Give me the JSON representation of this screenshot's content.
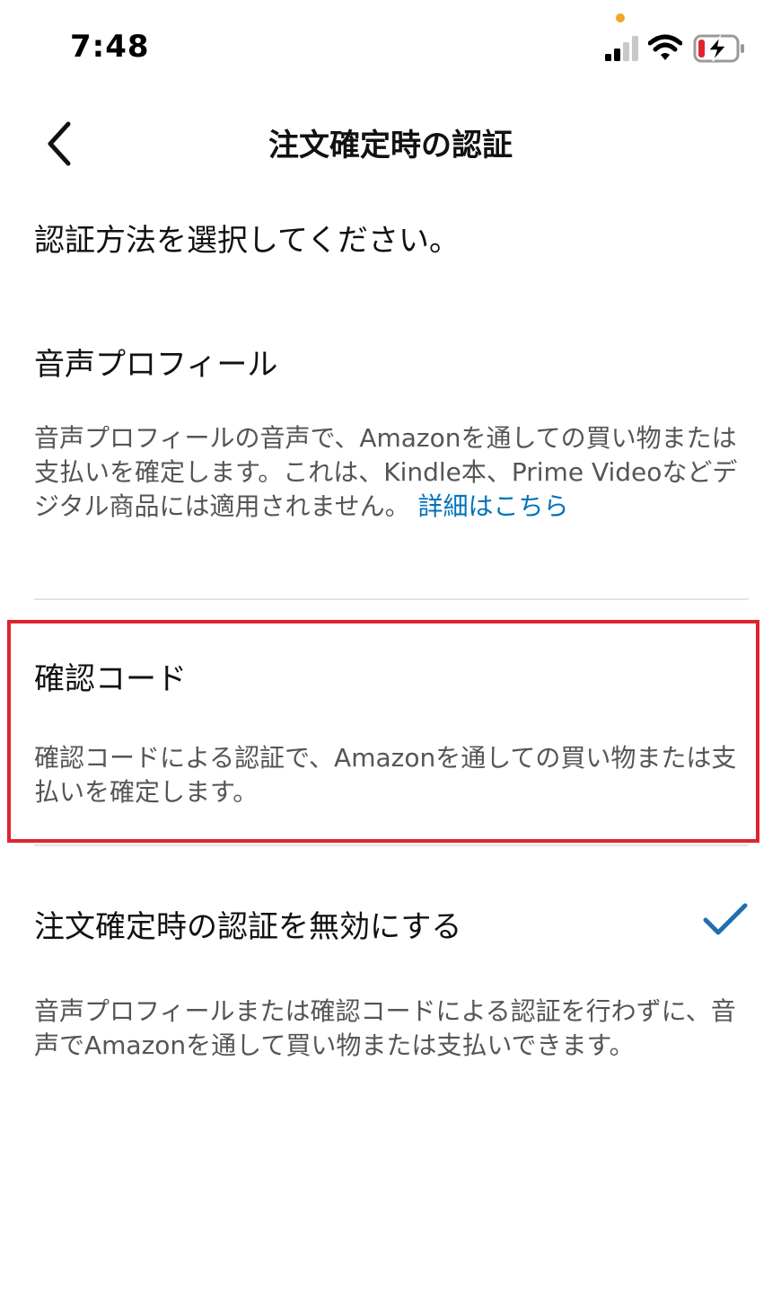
{
  "status_bar": {
    "time": "7:48",
    "icons": [
      "signal-icon",
      "wifi-icon",
      "battery-charging-icon"
    ],
    "orange_dot_color": "#f5a623"
  },
  "nav": {
    "title": "注文確定時の認証",
    "back_icon": "chevron-left-icon"
  },
  "prompt": "認証方法を選択してください。",
  "options": [
    {
      "title": "音声プロフィール",
      "description": "音声プロフィールの音声で、Amazonを通しての買い物または支払いを確定します。これは、Kindle本、Prime Videoなどデジタル商品には適用されません。",
      "link": "詳細はこちら",
      "selected": false
    },
    {
      "title": "確認コード",
      "description": "確認コードによる認証で、Amazonを通しての買い物または支払いを確定します。",
      "selected": false
    },
    {
      "title": "注文確定時の認証を無効にする",
      "description": "音声プロフィールまたは確認コードによる認証を行わずに、音声でAmazonを通して買い物または支払いできます。",
      "selected": true
    }
  ],
  "colors": {
    "link": "#0073bb",
    "check": "#1f6fb2",
    "highlight": "#e0242c",
    "battery_low": "#e0242c"
  }
}
